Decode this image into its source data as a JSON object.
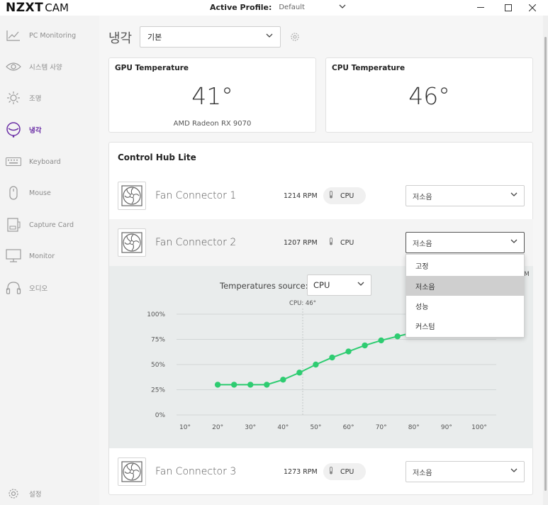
{
  "app": {
    "brand": "NZXT",
    "product": "CAM"
  },
  "titlebar": {
    "profile_label": "Active Profile:",
    "profile_value": "Default"
  },
  "sidebar": {
    "items": [
      {
        "label": "PC Monitoring",
        "icon": "chart-line-icon"
      },
      {
        "label": "시스템 사양",
        "icon": "eye-icon"
      },
      {
        "label": "조명",
        "icon": "sun-icon"
      },
      {
        "label": "냉각",
        "icon": "fan-icon"
      },
      {
        "label": "Keyboard",
        "icon": "keyboard-icon"
      },
      {
        "label": "Mouse",
        "icon": "mouse-icon"
      },
      {
        "label": "Capture Card",
        "icon": "capture-card-icon"
      },
      {
        "label": "Monitor",
        "icon": "monitor-icon"
      },
      {
        "label": "오디오",
        "icon": "headphones-icon"
      }
    ],
    "settings_label": "설정",
    "active": "냉각",
    "accent": "#6b2fa6"
  },
  "main": {
    "title": "냉각",
    "preset": "기본",
    "gpu": {
      "title": "GPU Temperature",
      "value": "41°",
      "device": "AMD Radeon RX 9070"
    },
    "cpu": {
      "title": "CPU Temperature",
      "value": "46°"
    },
    "hub": {
      "title": "Control Hub Lite",
      "fans": [
        {
          "name": "Fan Connector 1",
          "rpm": "1214 RPM",
          "source": "CPU",
          "mode": "저소음"
        },
        {
          "name": "Fan Connector 2",
          "rpm": "1207 RPM",
          "source": "CPU",
          "mode": "저소음"
        },
        {
          "name": "Fan Connector 3",
          "rpm": "1273 RPM",
          "source": "CPU",
          "mode": "저소음"
        }
      ]
    },
    "curve": {
      "temp_source_label": "Temperatures source:",
      "temp_source": "CPU",
      "partial_text": "M"
    },
    "dropdown": {
      "options": [
        "고정",
        "저소음",
        "성능",
        "커스텀"
      ],
      "selected": "저소음"
    }
  },
  "chart_data": {
    "type": "line",
    "x": [
      20,
      25,
      30,
      35,
      40,
      45,
      50,
      55,
      60,
      65,
      70,
      75,
      80
    ],
    "values": [
      30,
      30,
      30,
      30,
      35,
      42,
      50,
      57,
      63,
      69,
      74,
      78,
      82
    ],
    "xticks": [
      "10°",
      "20°",
      "30°",
      "40°",
      "50°",
      "60°",
      "70°",
      "80°",
      "90°",
      "100°"
    ],
    "yticks": [
      "0%",
      "25%",
      "50%",
      "75%",
      "100%"
    ],
    "xlim": [
      10,
      100
    ],
    "ylim": [
      0,
      100
    ],
    "marker": {
      "x": 46,
      "label": "CPU: 46°"
    },
    "color": "#2ecc71",
    "grid": true
  }
}
